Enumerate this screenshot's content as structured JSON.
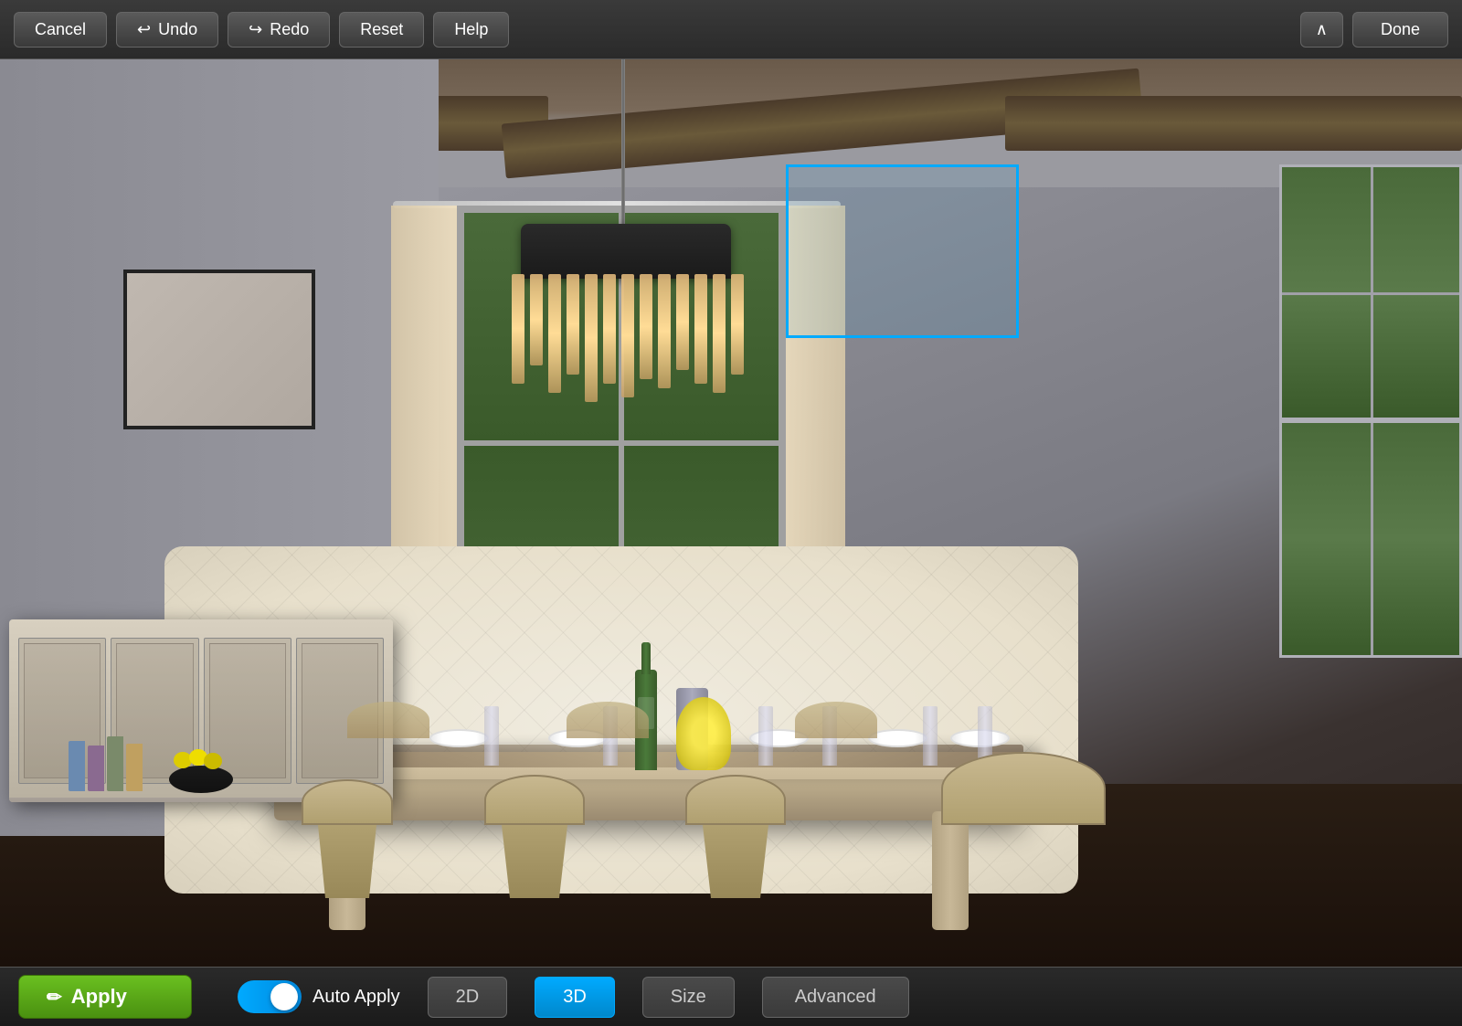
{
  "toolbar": {
    "cancel_label": "Cancel",
    "undo_label": "Undo",
    "redo_label": "Redo",
    "reset_label": "Reset",
    "help_label": "Help",
    "done_label": "Done"
  },
  "bottom_bar": {
    "apply_label": "Apply",
    "auto_apply_label": "Auto Apply",
    "view_2d_label": "2D",
    "view_3d_label": "3D",
    "size_label": "Size",
    "advanced_label": "Advanced",
    "toggle_state": "on"
  },
  "scene": {
    "description": "3D dining room interior visualization"
  }
}
